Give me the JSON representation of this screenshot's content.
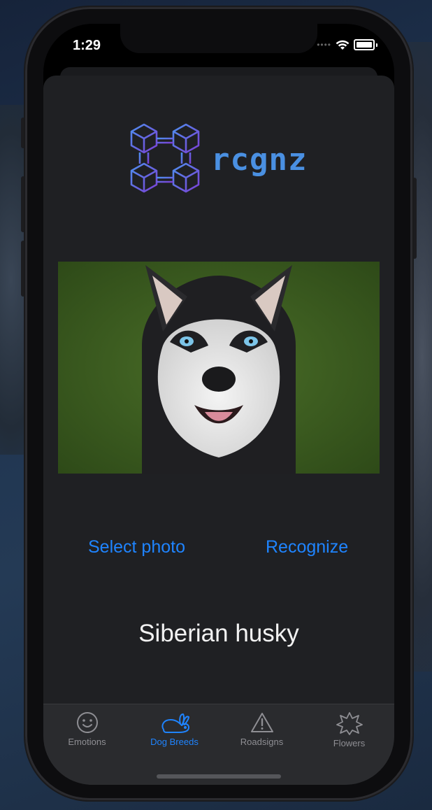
{
  "status_bar": {
    "time": "1:29",
    "signal_icon": "signal-dots-icon",
    "wifi_icon": "wifi-icon",
    "battery_icon": "battery-icon"
  },
  "app": {
    "logo_text": "rcgnz",
    "logo_icon": "cubes-logo-icon",
    "accent": "#1f84ff"
  },
  "photo": {
    "description_icon": "dog-photo",
    "alt": "Siberian husky"
  },
  "actions": {
    "select_label": "Select photo",
    "recognize_label": "Recognize"
  },
  "result": {
    "label": "Siberian husky"
  },
  "tabbar": {
    "tabs": [
      {
        "label": "Emotions",
        "icon": "smiley-icon",
        "active": false
      },
      {
        "label": "Dog Breeds",
        "icon": "rabbit-icon",
        "active": true
      },
      {
        "label": "Roadsigns",
        "icon": "warning-triangle-icon",
        "active": false
      },
      {
        "label": "Flowers",
        "icon": "star-burst-icon",
        "active": false
      }
    ]
  }
}
